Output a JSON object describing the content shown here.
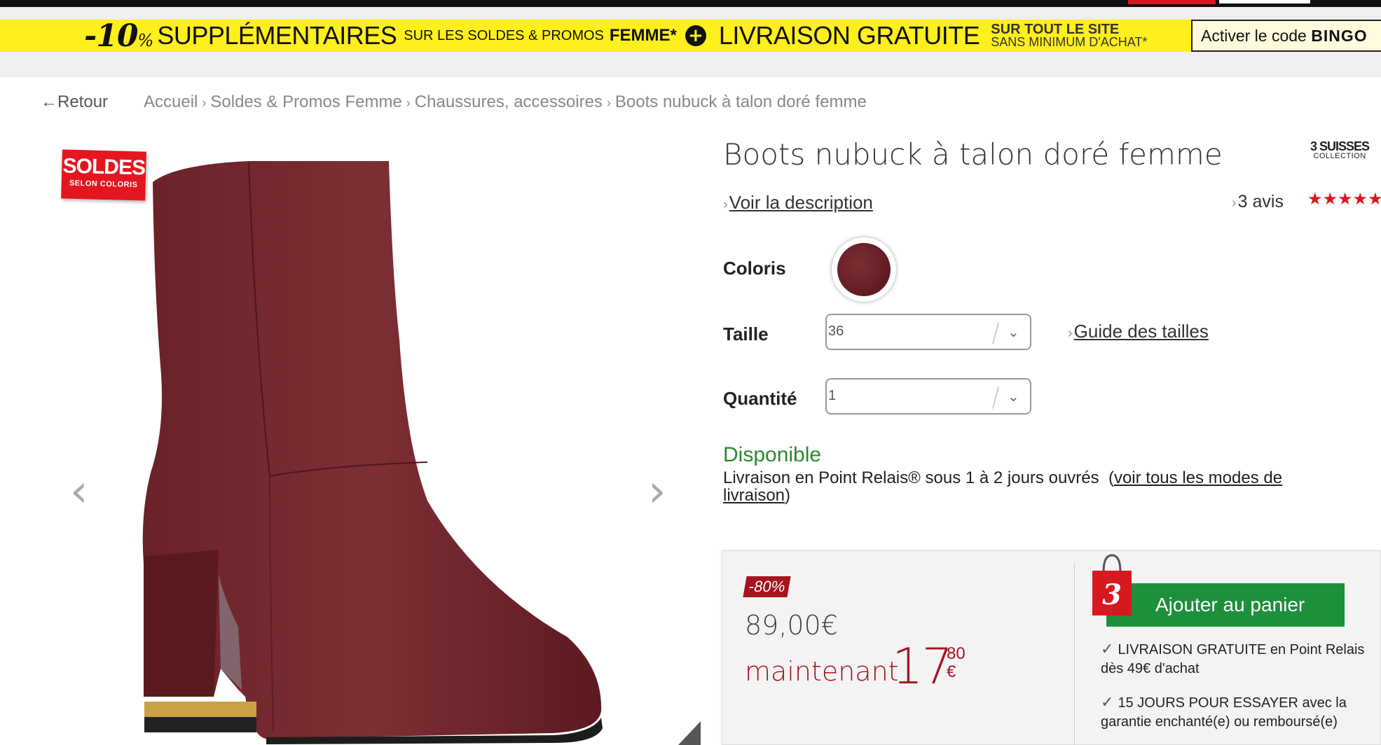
{
  "promo": {
    "pct_value": "-10",
    "pct_sign": "%",
    "supp": "SUPPLÉMENTAIRES",
    "sur_les": "SUR LES SOLDES & PROMOS",
    "femme": "FEMME*",
    "plus_icon": "plus-circle-icon",
    "livraison": "LIVRAISON GRATUITE",
    "site_line1": "SUR TOUT LE SITE",
    "site_line2": "SANS MINIMUM D'ACHAT*",
    "code_label": "Activer le code",
    "code": "BINGO"
  },
  "nav": {
    "back": "Retour",
    "breadcrumb": [
      "Accueil",
      "Soldes & Promos Femme",
      "Chaussures, accessoires",
      "Boots nubuck à talon doré femme"
    ]
  },
  "gallery": {
    "badge_line1": "SOLDES",
    "badge_line2": "SELON COLORIS",
    "prev": "‹",
    "next": "›"
  },
  "product": {
    "title": "Boots nubuck à talon doré femme",
    "brand_line1": "3 SUISSES",
    "brand_line2": "COLLECTION",
    "desc_link": "Voir la description",
    "reviews": "3 avis",
    "stars": "★★★★★",
    "color_label": "Coloris",
    "swatch_color": "#6b2329",
    "size_label": "Taille",
    "size_value": "36",
    "size_guide": "Guide des tailles",
    "qty_label": "Quantité",
    "qty_value": "1",
    "availability": "Disponible",
    "delivery_text": "Livraison en Point Relais® sous 1 à 2 jours ouvrés",
    "delivery_link": "voir tous les modes de livraison"
  },
  "price": {
    "discount": "-80%",
    "old": "89,00€",
    "now_label": "maintenant",
    "now_int": "17",
    "now_dec": "80",
    "currency": "€"
  },
  "buy": {
    "cart_button": "Ajouter au panier",
    "perk1": "LIVRAISON GRATUITE en Point Relais dès 49€ d'achat",
    "perk2": "15 JOURS POUR ESSAYER avec la garantie enchanté(e) ou remboursé(e)"
  },
  "colors": {
    "brand_red": "#d6181f",
    "price_red": "#a5141f",
    "cart_green": "#1e8f3a",
    "promo_yellow": "#ffef1c"
  }
}
